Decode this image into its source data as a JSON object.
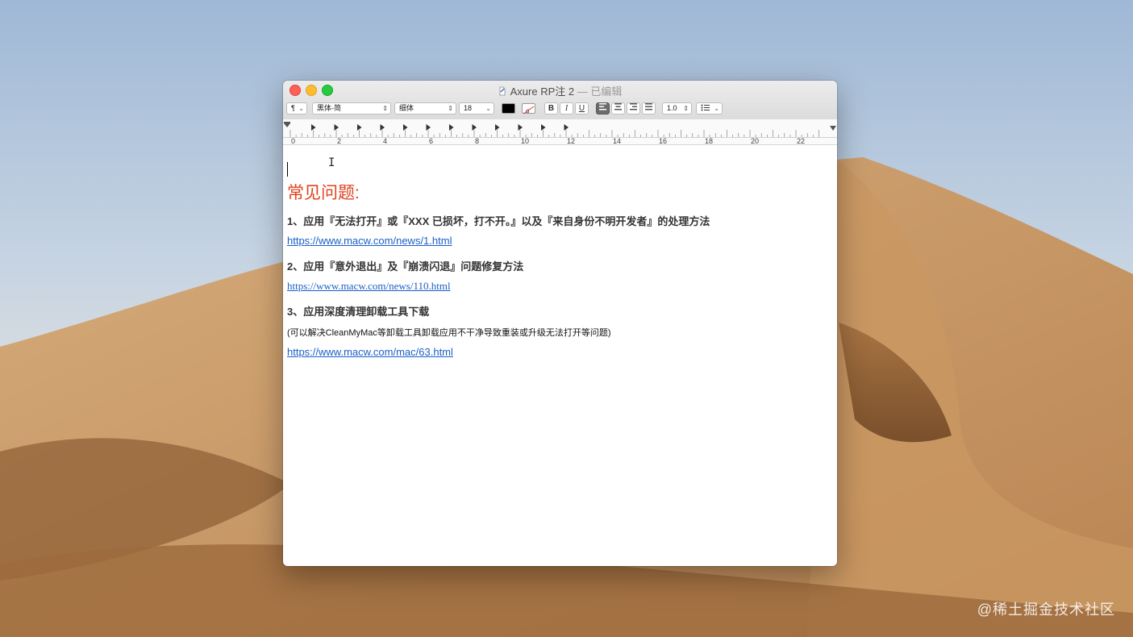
{
  "window": {
    "title": "Axure RP注 2",
    "title_separator": " — ",
    "edited_label": "已编辑"
  },
  "toolbar": {
    "paragraph_style": "¶",
    "font_family": "黑体-简",
    "font_weight": "细体",
    "font_size": "18",
    "bold_label": "B",
    "italic_label": "I",
    "underline_label": "U",
    "line_spacing": "1.0",
    "text_color": "#000000"
  },
  "ruler": {
    "labels": [
      "0",
      "2",
      "4",
      "6",
      "8",
      "10",
      "12",
      "14",
      "16",
      "18",
      "20",
      "22"
    ]
  },
  "document": {
    "heading": "常见问题:",
    "item1": "1、应用『无法打开』或『XXX 已损坏，打不开。』以及『来自身份不明开发者』的处理方法",
    "link1": "https://www.macw.com/news/1.html",
    "item2": "2、应用『意外退出』及『崩溃闪退』问题修复方法",
    "link2": "https://www.macw.com/news/110.html",
    "item3": "3、应用深度清理卸载工具下载",
    "note3": "(可以解决CleanMyMac等卸载工具卸载应用不干净导致重装或升级无法打开等问题)",
    "link3": "https://www.macw.com/mac/63.html"
  },
  "watermark": "@稀土掘金技术社区",
  "colors": {
    "heading": "#e0421f",
    "link": "#1a5fc8",
    "close": "#fe5f57",
    "minimize": "#febc2e",
    "maximize": "#28c840"
  }
}
